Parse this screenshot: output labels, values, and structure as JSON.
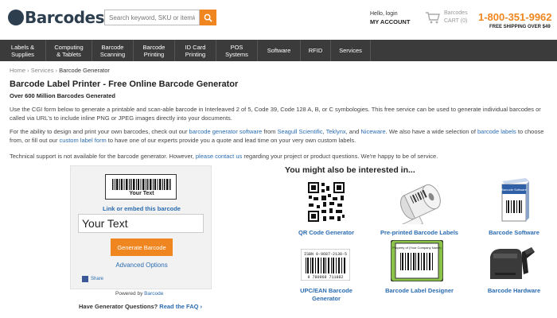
{
  "header": {
    "logo_text": "Barcodes",
    "search_placeholder": "Search keyword, SKU or item#",
    "greeting": "Hello, login",
    "my_account": "MY ACCOUNT",
    "cart_label": "Barcodes",
    "cart_count": "CART (0)",
    "phone": "1-800-351-9962",
    "shipping": "FREE SHIPPING OVER $49"
  },
  "nav": [
    {
      "label": "Labels &\nSupplies"
    },
    {
      "label": "Computing\n& Tablets"
    },
    {
      "label": "Barcode\nScanning"
    },
    {
      "label": "Barcode\nPrinting"
    },
    {
      "label": "ID Card\nPrinting"
    },
    {
      "label": "POS\nSystems"
    },
    {
      "label": "Software"
    },
    {
      "label": "RFID"
    },
    {
      "label": "Services"
    }
  ],
  "breadcrumb": {
    "home": "Home",
    "sep1": " › ",
    "services": "Services",
    "sep2": " › ",
    "current": "Barcode Generator"
  },
  "page": {
    "title": "Barcode Label Printer - Free Online Barcode Generator",
    "subtitle": "Over 600 Million Barcodes Generated",
    "para1": "Use the CGI form below to generate a printable and scan-able barcode in Interleaved 2 of 5, Code 39, Code 128 A, B, or C symbologies. This free service can be used to generate individual barcodes or called via URL's to include inline PNG or JPEG images directly into your documents.",
    "para2_a": "For the ability to design and print your own barcodes, check out our ",
    "para2_link1": "barcode generator software",
    "para2_b": " from ",
    "para2_link2": "Seagull Scientific",
    "para2_c": ", ",
    "para2_link3": "Teklynx",
    "para2_d": ", and ",
    "para2_link4": "Niceware",
    "para2_e": ". We also have a wide selection of ",
    "para2_link5": "barcode labels",
    "para2_f": " to choose from, or fill out our ",
    "para2_link6": "custom label form",
    "para2_g": " to have one of our experts provide you a quote and lead time on your very own custom labels.",
    "para3_a": "Technical support is not available for the barcode generator. However, ",
    "para3_link": "please contact us",
    "para3_b": " regarding your project or product questions. We're happy to be of service."
  },
  "generator": {
    "preview_text": "Your Text",
    "embed_link": "Link or embed this barcode",
    "input_value": "Your Text",
    "generate_button": "Generate Barcode",
    "advanced": "Advanced Options",
    "share": "Share",
    "powered_by": "Powered by ",
    "powered_link": "Barcode",
    "faq_q": "Have Generator Questions? ",
    "faq_link": "Read the FAQ ›"
  },
  "suggestions": {
    "heading": "You might also be interested in...",
    "items": [
      {
        "label": "QR Code Generator"
      },
      {
        "label": "Pre-printed Barcode Labels"
      },
      {
        "label": "Barcode Software"
      },
      {
        "label": "UPC/EAN Barcode Generator"
      },
      {
        "label": "Barcode Label Designer"
      },
      {
        "label": "Barcode Hardware"
      }
    ],
    "upc_text": "ISBN 0-9687-2138-5",
    "upc_digits": "9 780968 711882",
    "designer_top": "Property of (Your Company Name)",
    "software_box": "Barcode Software"
  },
  "colors": {
    "accent": "#f0861f",
    "nav_bg": "#3b3b3b",
    "link": "#2b6cb0"
  }
}
